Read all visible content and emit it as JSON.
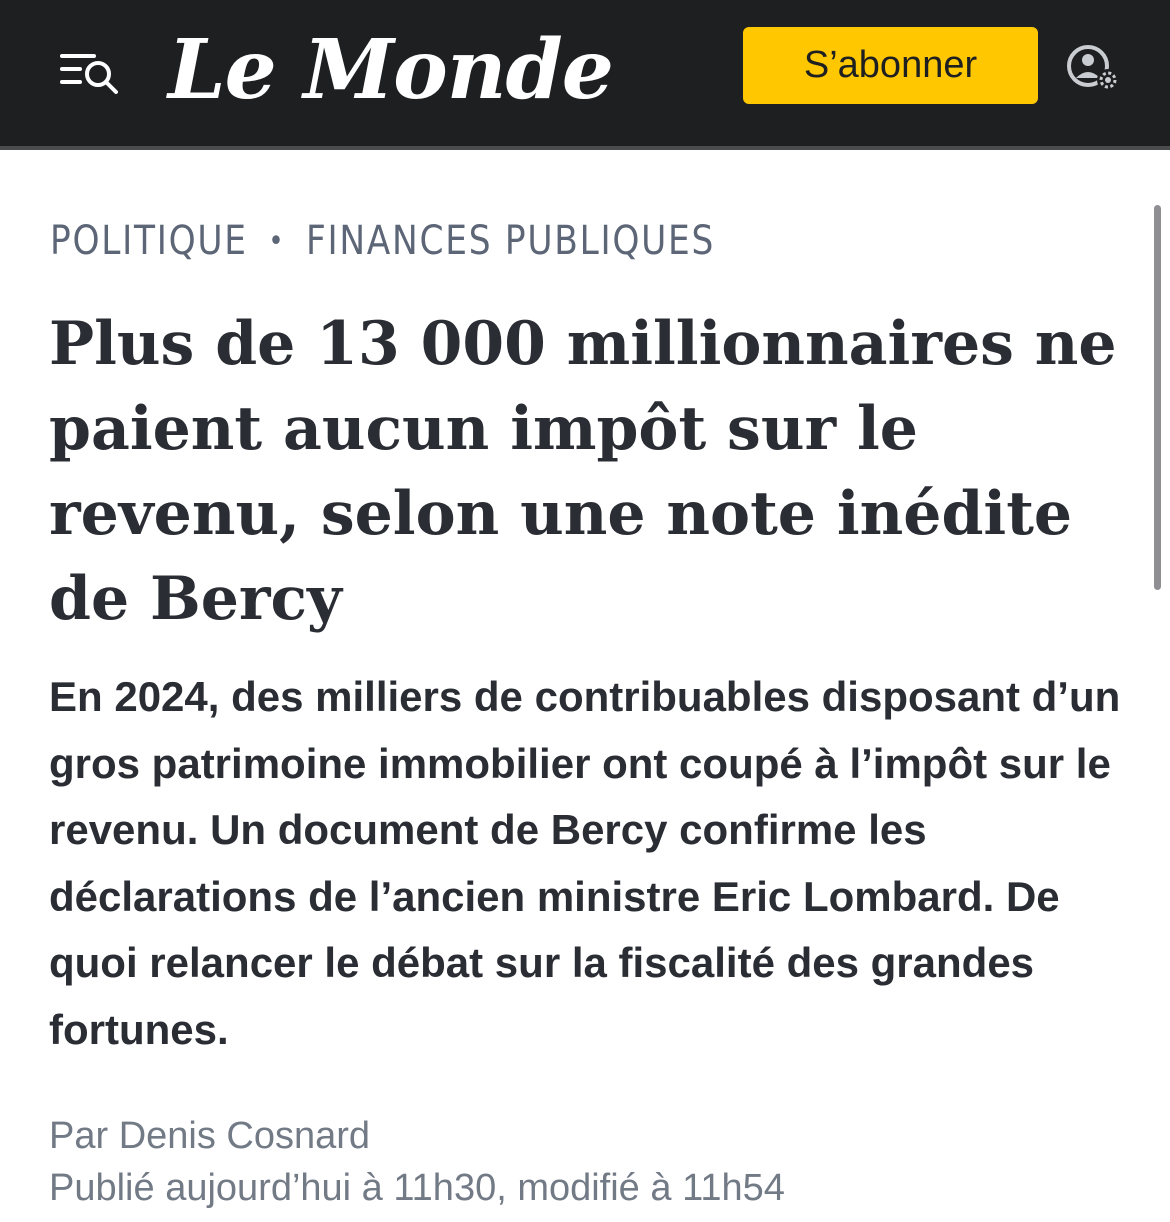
{
  "header": {
    "menu_icon": "menu-search-icon",
    "logo": "Le Monde",
    "subscribe_label": "S’abonner",
    "account_icon": "account-settings-icon",
    "colors": {
      "bar_background": "#1d1f21",
      "subscribe_background": "#ffc700"
    }
  },
  "article": {
    "category": "POLITIQUE",
    "subcategory": "FINANCES PUBLIQUES",
    "separator": "•",
    "headline": "Plus de 13 000 millionnaires ne paient aucun impôt sur le revenu, selon une note inédite de Bercy",
    "standfirst": "En 2024, des milliers de contribuables disposant d’un gros patrimoine immobilier ont coupé à l’impôt sur le revenu. Un document de Bercy confirme les déclarations de l’ancien ministre Eric Lombard. De quoi relancer le débat sur la fiscalité des grandes fortunes.",
    "byline_prefix": "Par",
    "author": "Denis Cosnard",
    "published": "Publié aujourd’hui à 11h30, modifié à 11h54"
  }
}
